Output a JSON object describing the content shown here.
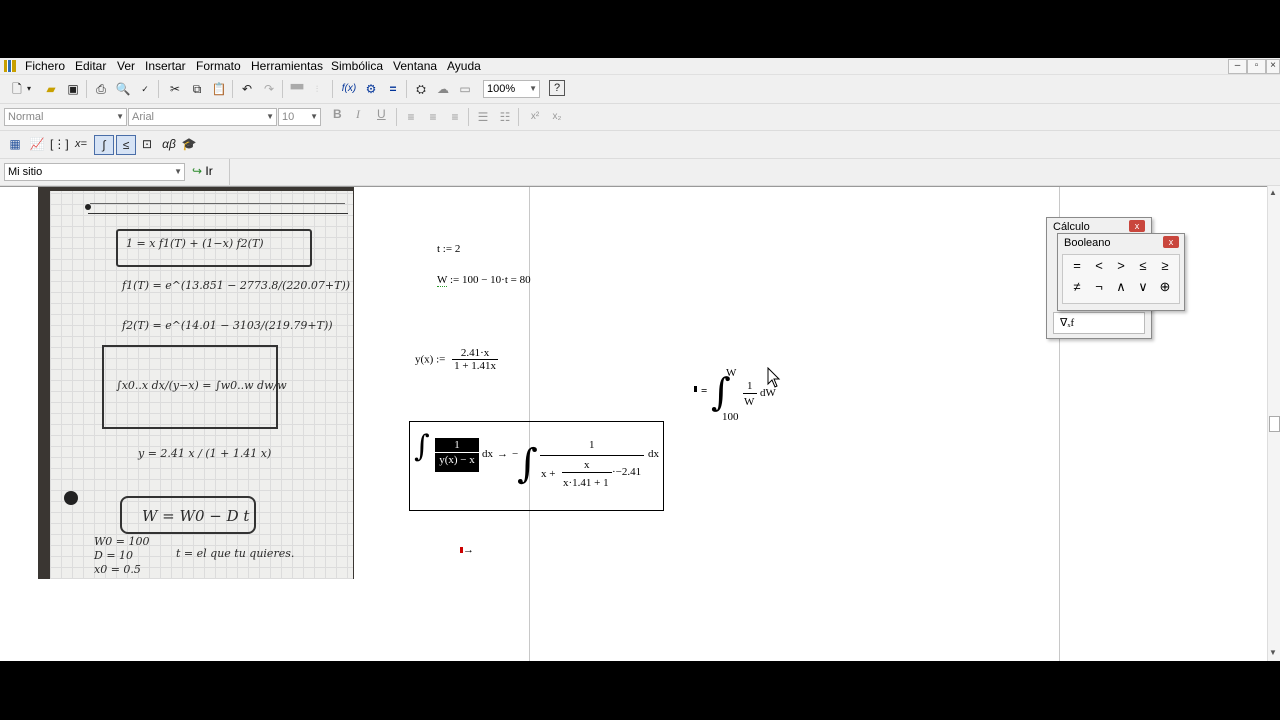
{
  "menu": {
    "items": [
      "Fichero",
      "Editar",
      "Ver",
      "Insertar",
      "Formato",
      "Herramientas",
      "Simbólica",
      "Ventana",
      "Ayuda"
    ]
  },
  "window_controls": {
    "minimize": "–",
    "restore": "▫",
    "close": "×"
  },
  "toolbar_standard": {
    "zoom": "100%",
    "icons": [
      "new-icon",
      "open-icon",
      "save-icon",
      "print-icon",
      "preview-icon",
      "spellcheck-icon",
      "cut-icon",
      "copy-icon",
      "paste-icon",
      "undo-icon",
      "redo-icon",
      "align-top-icon",
      "align-bottom-icon",
      "insert-function-icon",
      "insert-unit-icon",
      "calculate-icon",
      "component-icon",
      "resource-icon",
      "region-icon",
      "help-icon"
    ]
  },
  "toolbar_format": {
    "style": "Normal",
    "font": "Arial",
    "size": "10",
    "bold": "B",
    "italic": "I",
    "underline": "U"
  },
  "toolbar_math": {
    "icons": [
      "calculator-toolbar-icon",
      "graph-toolbar-icon",
      "matrix-toolbar-icon",
      "evaluation-toolbar-icon",
      "calculus-toolbar-icon",
      "boolean-toolbar-icon",
      "programming-toolbar-icon",
      "greek-toolbar-icon",
      "symbolic-toolbar-icon"
    ]
  },
  "toolbar_web": {
    "site": "Mi sitio",
    "go_label": "Ir"
  },
  "notebook": {
    "lines": [
      "1 = x f1(T) + (1−x) f2(T)",
      "f1(T) = e^(13.851 − 2773.8/(220.07+T))",
      "f2(T) = e^(14.01 − 3103/(219.79+T))",
      "∫x0..x dx/(y−x) = ∫w0..w dw/w",
      "y = 2.41 x / (1 + 1.41 x)",
      "W = W0 − D t",
      "W0 = 100",
      "D = 10",
      "x0 = 0.5",
      "t = el que tu quieres."
    ]
  },
  "worksheet": {
    "t_def": "t := 2",
    "w_def_var": "W",
    "w_def_expr": ":= 100 − 10·t = 80",
    "y_def_lhs": "y(x) :=",
    "y_def_num": "2.41·x",
    "y_def_den": "1 + 1.41x",
    "integral_lhs_num": "1",
    "integral_lhs_den": "y(x) − x",
    "integral_dx": "dx",
    "integral_arrow": "→",
    "integral_neg": "−",
    "integral_rhs_num": "1",
    "integral_rhs_den_a": "x +",
    "integral_rhs_inner_num": "x",
    "integral_rhs_inner_den": "x·1.41 + 1",
    "integral_rhs_tail": "·−2.41",
    "w_integral_eq": "=",
    "w_integral_upper": "W",
    "w_integral_lower": "100",
    "w_integral_num": "1",
    "w_integral_den": "W",
    "w_integral_d": "dW",
    "placeholder_arrow": "→"
  },
  "palette_calculo": {
    "title": "Cálculo",
    "close": "x",
    "bottom_symbol": "∇ₓf"
  },
  "palette_booleano": {
    "title": "Booleano",
    "close": "x",
    "row1": [
      "=",
      "<",
      ">",
      "≤",
      "≥"
    ],
    "row2": [
      "≠",
      "¬",
      "∧",
      "∨",
      "⊕"
    ]
  }
}
